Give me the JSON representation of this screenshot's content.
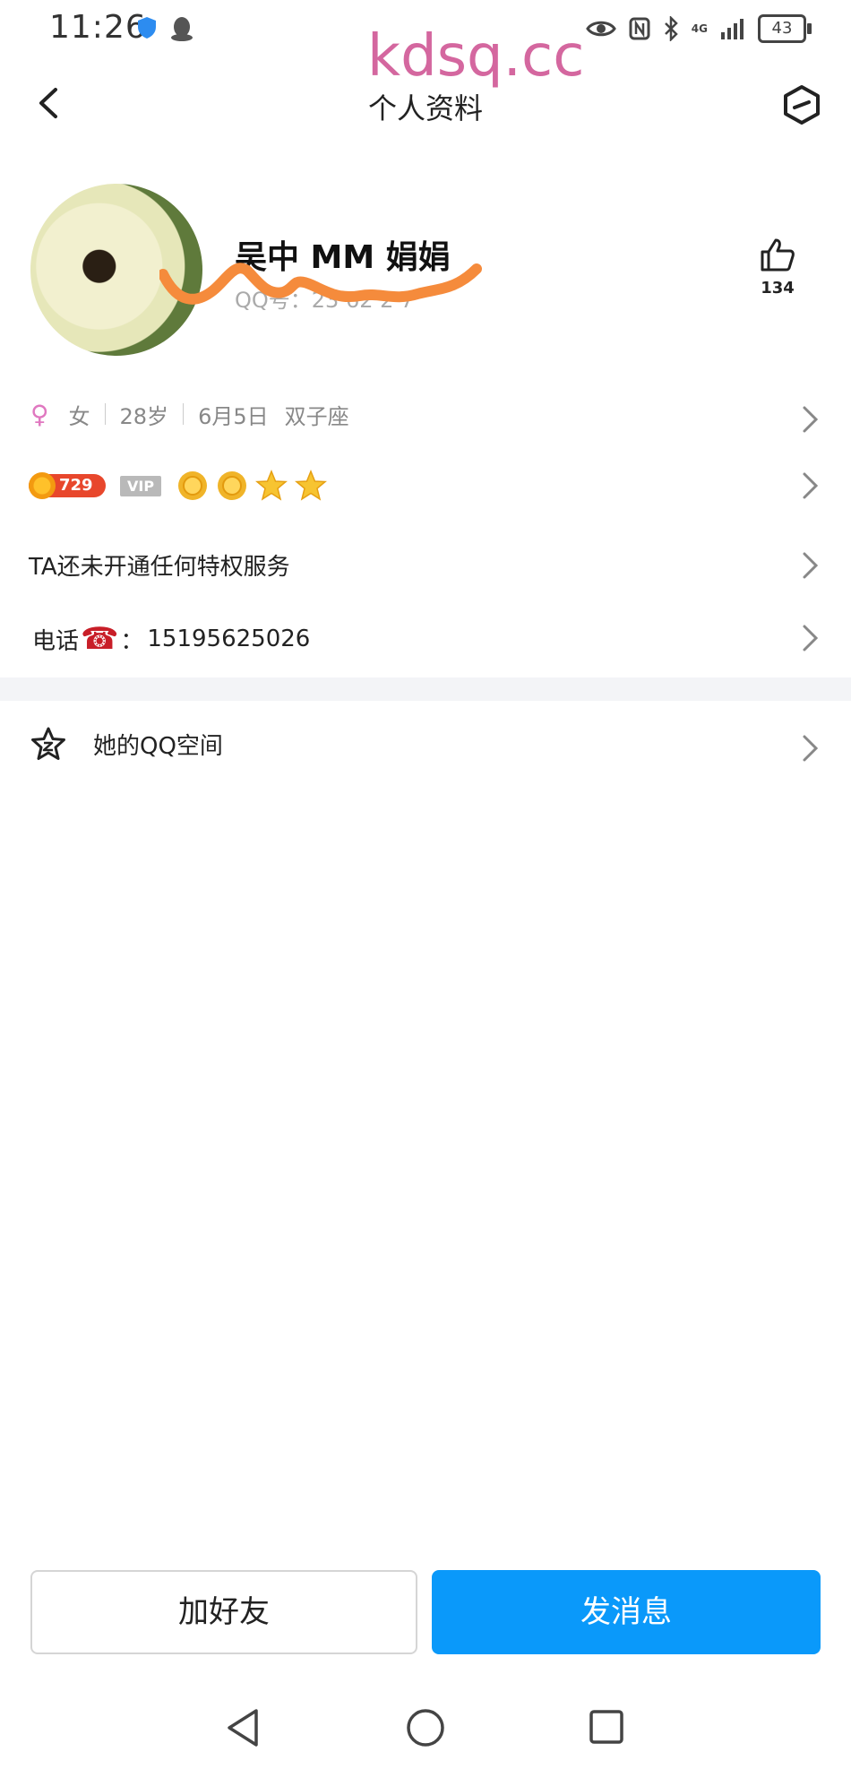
{
  "status_bar": {
    "time": "11:26",
    "battery": "43",
    "network": "4G"
  },
  "watermark": "kdsq.cc",
  "header": {
    "title": "个人资料"
  },
  "profile": {
    "nickname": "吴中 MM 娟娟",
    "qq_label": "QQ号：",
    "qq_visible_digits": "23 62 2 7",
    "like_count": "134"
  },
  "info": {
    "gender": "女",
    "age": "28岁",
    "birthday": "6月5日",
    "zodiac": "双子座"
  },
  "badges": {
    "level": "729",
    "vip": "VIP"
  },
  "privilege_text": "TA还未开通任何特权服务",
  "phone": {
    "label": "电话",
    "separator": "：",
    "number": "15195625026"
  },
  "qzone": {
    "label": "她的QQ空间"
  },
  "actions": {
    "add_friend": "加好友",
    "send_message": "发消息"
  },
  "colors": {
    "accent_blue": "#0a99fa",
    "scribble_orange": "#f58b3c",
    "watermark_pink": "#d4679f"
  }
}
